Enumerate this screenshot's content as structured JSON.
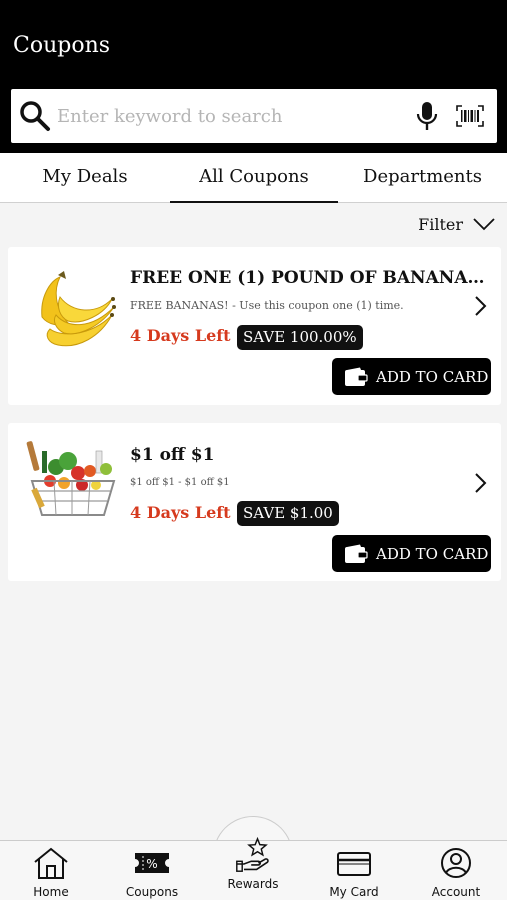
{
  "header": {
    "title": "Coupons"
  },
  "search": {
    "placeholder": "Enter keyword to search"
  },
  "tabs": [
    {
      "label": "My Deals"
    },
    {
      "label": "All Coupons",
      "active": true
    },
    {
      "label": "Departments"
    }
  ],
  "filter": {
    "label": "Filter"
  },
  "coupons": [
    {
      "name": "FREE ONE (1) POUND OF BANANAS (US...",
      "desc": "FREE BANANAS! - Use this coupon one (1) time.",
      "days": "4 Days Left",
      "save": "SAVE 100.00%",
      "button": "ADD TO CARD",
      "image": "bananas"
    },
    {
      "name": "$1 off $1",
      "desc": "$1 off $1 - $1 off $1",
      "days": "4 Days Left",
      "save": "SAVE $1.00",
      "button": "ADD TO CARD",
      "image": "grocery-basket"
    }
  ],
  "bottom_nav": [
    {
      "label": "Home",
      "icon": "home-icon"
    },
    {
      "label": "Coupons",
      "icon": "coupon-icon"
    },
    {
      "label": "Rewards",
      "icon": "rewards-icon"
    },
    {
      "label": "My Card",
      "icon": "card-icon"
    },
    {
      "label": "Account",
      "icon": "account-icon"
    }
  ],
  "colors": {
    "accent_red": "#d63a1e",
    "header_bg": "#000000"
  }
}
